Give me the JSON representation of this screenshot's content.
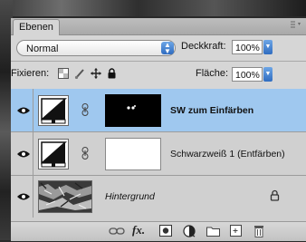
{
  "panel": {
    "tab_label": "Ebenen",
    "menu_icon": "panel-menu-icon"
  },
  "blend": {
    "mode": "Normal",
    "opacity_label": "Deckkraft:",
    "opacity_value": "100%"
  },
  "lock": {
    "label": "Fixieren:",
    "fill_label": "Fläche:",
    "fill_value": "100%"
  },
  "layers": [
    {
      "name": "SW zum Einfärben",
      "selected": true,
      "visible": true,
      "type": "adjustment",
      "mask": "black"
    },
    {
      "name": "Schwarzweiß 1 (Entfärben)",
      "selected": false,
      "visible": true,
      "type": "adjustment",
      "mask": "white"
    },
    {
      "name": "Hintergrund",
      "selected": false,
      "visible": true,
      "type": "background",
      "locked": true
    }
  ],
  "bottom_icons": [
    "link-icon",
    "fx-icon",
    "mask-icon",
    "adjustment-icon",
    "folder-icon",
    "new-layer-icon",
    "trash-icon"
  ],
  "colors": {
    "selected_row": "#9fc8ef",
    "panel_bg": "#d6d6d6",
    "accent_blue": "#2f6cc0"
  }
}
